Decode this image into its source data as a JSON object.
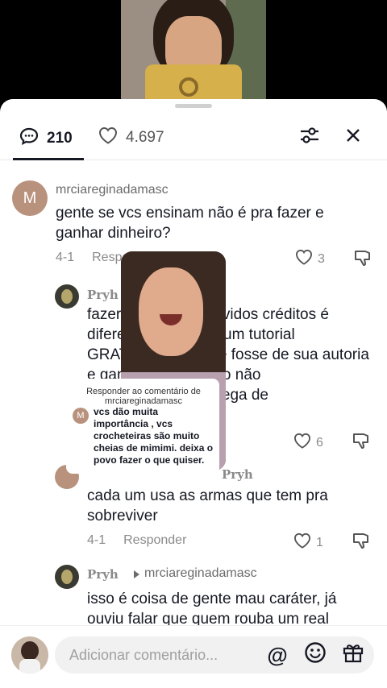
{
  "tabs": {
    "comments_count": "210",
    "likes_count": "4.697"
  },
  "comments": [
    {
      "avatar_letter": "M",
      "username": "mrciareginadamasc",
      "text_lines": [
        "gente se vcs ensinam não é pra fazer e",
        "ganhar dinheiro?"
      ],
      "date": "4-1",
      "reply_label": "Responder",
      "likes": "3"
    },
    {
      "username": "Pryh",
      "text_lines": [
        "fazer sem dar os devidos créditos é",
        "diferente de vender um tutorial",
        "GRATUITO como se fosse de sua autoria",
        "e ganhar em cima do não",
        "trabalho de uma colega de"
      ],
      "likes": "6"
    },
    {
      "username": "Pryh",
      "text_lines": [
        "cada um usa as armas que tem pra",
        "sobreviver"
      ],
      "date": "4-1",
      "reply_label": "Responder",
      "likes": "1"
    },
    {
      "username": "Pryh",
      "reply_to": "mrciareginadamasc",
      "text_lines": [
        "isso é coisa de gente mau caráter, já",
        "ouviu falar que quem rouba um real"
      ]
    }
  ],
  "overlay": {
    "label": "Responder ao comentário de mrciareginadamasc",
    "avatar_letter": "M",
    "body": "vcs dão muita importância , vcs crocheteiras são muito cheias de mimimi. deixa o povo fazer o que quiser."
  },
  "input": {
    "placeholder": "Adicionar comentário...",
    "at_symbol": "@"
  }
}
